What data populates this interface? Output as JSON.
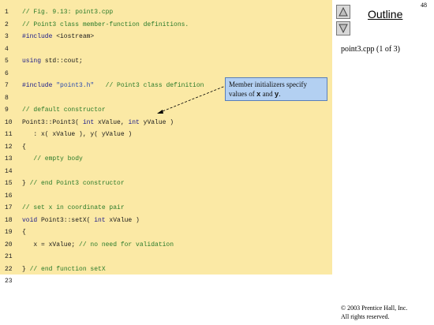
{
  "page_number": "48",
  "outline": {
    "title": "Outline",
    "file_label": "point3.cpp (1 of 3)"
  },
  "callout": {
    "text_prefix": "Member initializers specify values of ",
    "var1": "x",
    "text_middle": " and ",
    "var2": "y",
    "text_suffix": "."
  },
  "code_lines": [
    {
      "n": "1",
      "segments": [
        {
          "t": "// Fig. 9.13: point3.cpp",
          "c": "c-comment"
        }
      ]
    },
    {
      "n": "2",
      "segments": [
        {
          "t": "// Point3 class member-function definitions.",
          "c": "c-comment"
        }
      ]
    },
    {
      "n": "3",
      "segments": [
        {
          "t": "#include",
          "c": "c-pre"
        },
        {
          "t": " <iostream>",
          "c": ""
        }
      ]
    },
    {
      "n": "4",
      "segments": []
    },
    {
      "n": "5",
      "segments": [
        {
          "t": "using",
          "c": "c-kw"
        },
        {
          "t": " std::cout;",
          "c": ""
        }
      ]
    },
    {
      "n": "6",
      "segments": []
    },
    {
      "n": "7",
      "segments": [
        {
          "t": "#include",
          "c": "c-pre"
        },
        {
          "t": " ",
          "c": ""
        },
        {
          "t": "\"point3.h\"",
          "c": "c-str"
        },
        {
          "t": "   // Point3 class definition",
          "c": "c-comment"
        }
      ]
    },
    {
      "n": "8",
      "segments": []
    },
    {
      "n": "9",
      "segments": [
        {
          "t": "// default constructor",
          "c": "c-comment"
        }
      ]
    },
    {
      "n": "10",
      "segments": [
        {
          "t": "Point3::Point3( ",
          "c": ""
        },
        {
          "t": "int",
          "c": "c-kw"
        },
        {
          "t": " xValue, ",
          "c": ""
        },
        {
          "t": "int",
          "c": "c-kw"
        },
        {
          "t": " yValue )",
          "c": ""
        }
      ]
    },
    {
      "n": "11",
      "segments": [
        {
          "t": "   : x( xValue ), y( yValue )",
          "c": ""
        }
      ]
    },
    {
      "n": "12",
      "segments": [
        {
          "t": "{",
          "c": ""
        }
      ]
    },
    {
      "n": "13",
      "segments": [
        {
          "t": "   // empty body",
          "c": "c-comment"
        }
      ]
    },
    {
      "n": "14",
      "segments": []
    },
    {
      "n": "15",
      "segments": [
        {
          "t": "} ",
          "c": ""
        },
        {
          "t": "// end Point3 constructor",
          "c": "c-comment"
        }
      ]
    },
    {
      "n": "16",
      "segments": []
    },
    {
      "n": "17",
      "segments": [
        {
          "t": "// set x in coordinate pair",
          "c": "c-comment"
        }
      ]
    },
    {
      "n": "18",
      "segments": [
        {
          "t": "void",
          "c": "c-kw"
        },
        {
          "t": " Point3::setX( ",
          "c": ""
        },
        {
          "t": "int",
          "c": "c-kw"
        },
        {
          "t": " xValue )",
          "c": ""
        }
      ]
    },
    {
      "n": "19",
      "segments": [
        {
          "t": "{",
          "c": ""
        }
      ]
    },
    {
      "n": "20",
      "segments": [
        {
          "t": "   x = xValue; ",
          "c": ""
        },
        {
          "t": "// no need for validation",
          "c": "c-comment"
        }
      ]
    },
    {
      "n": "21",
      "segments": []
    },
    {
      "n": "22",
      "segments": [
        {
          "t": "} ",
          "c": ""
        },
        {
          "t": "// end function setX",
          "c": "c-comment"
        }
      ]
    },
    {
      "n": "23",
      "segments": []
    }
  ],
  "copyright": {
    "line1": "© 2003 Prentice Hall, Inc.",
    "line2": "All rights reserved."
  },
  "icons": {
    "prev": "up-triangle-icon",
    "next": "down-triangle-icon"
  }
}
